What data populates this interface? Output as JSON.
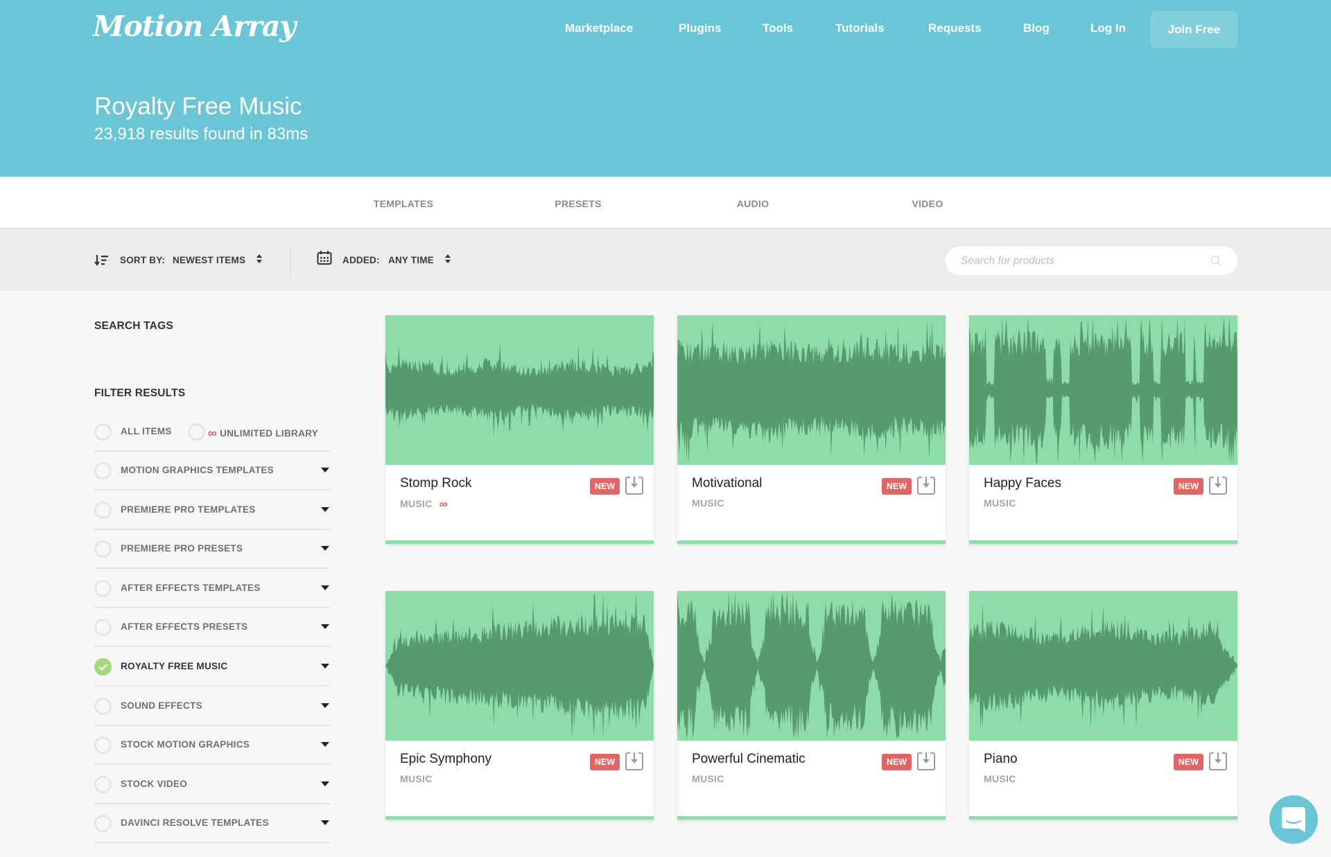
{
  "brand": {
    "logo_text": "Motion Array",
    "primary_color": "#6ac5d6",
    "accent_red": "#e06666",
    "wave_bg": "#8fdcab",
    "wave_fg": "#579a70",
    "check_green": "#a3d97e"
  },
  "nav": {
    "items": [
      "Marketplace",
      "Plugins",
      "Tools",
      "Tutorials",
      "Requests",
      "Blog",
      "Log In"
    ],
    "join_label": "Join Free"
  },
  "hero": {
    "title": "Royalty Free Music",
    "subtitle": "23,918 results found in 83ms"
  },
  "tabs": [
    "TEMPLATES",
    "PRESETS",
    "AUDIO",
    "VIDEO"
  ],
  "toolbar": {
    "sort_label": "SORT BY:",
    "sort_value": "NEWEST ITEMS",
    "added_label": "ADDED:",
    "added_value": "ANY TIME",
    "search_placeholder": "Search for products",
    "search_value": ""
  },
  "sidebar": {
    "search_tags_heading": "SEARCH TAGS",
    "filter_heading": "FILTER RESULTS",
    "top_options": [
      {
        "label": "ALL ITEMS",
        "checked": false
      },
      {
        "label": "UNLIMITED LIBRARY",
        "checked": false,
        "icon": "infinity-icon"
      }
    ],
    "filters": [
      {
        "label": "MOTION GRAPHICS TEMPLATES",
        "checked": false
      },
      {
        "label": "PREMIERE PRO TEMPLATES",
        "checked": false
      },
      {
        "label": "PREMIERE PRO PRESETS",
        "checked": false
      },
      {
        "label": "AFTER EFFECTS TEMPLATES",
        "checked": false
      },
      {
        "label": "AFTER EFFECTS PRESETS",
        "checked": false
      },
      {
        "label": "ROYALTY FREE MUSIC",
        "checked": true
      },
      {
        "label": "SOUND EFFECTS",
        "checked": false
      },
      {
        "label": "STOCK MOTION GRAPHICS",
        "checked": false
      },
      {
        "label": "STOCK VIDEO",
        "checked": false
      },
      {
        "label": "DAVINCI RESOLVE TEMPLATES",
        "checked": false
      }
    ]
  },
  "cards": [
    {
      "title": "Stomp Rock",
      "category": "MUSIC",
      "badge": "NEW",
      "unlimited": true,
      "wave": "steady"
    },
    {
      "title": "Motivational",
      "category": "MUSIC",
      "badge": "NEW",
      "unlimited": false,
      "wave": "dense"
    },
    {
      "title": "Happy Faces",
      "category": "MUSIC",
      "badge": "NEW",
      "unlimited": false,
      "wave": "sections"
    },
    {
      "title": "Epic Symphony",
      "category": "MUSIC",
      "badge": "NEW",
      "unlimited": false,
      "wave": "swell"
    },
    {
      "title": "Powerful Cinematic",
      "category": "MUSIC",
      "badge": "NEW",
      "unlimited": false,
      "wave": "blocks"
    },
    {
      "title": "Piano",
      "category": "MUSIC",
      "badge": "NEW",
      "unlimited": false,
      "wave": "fade"
    }
  ],
  "icons": {
    "sort": "sort-descending-icon",
    "calendar": "calendar-icon",
    "search": "search-icon",
    "download": "download-icon",
    "unlimited": "infinity-icon",
    "chat": "chat-icon",
    "infinity_glyph": "∞"
  }
}
